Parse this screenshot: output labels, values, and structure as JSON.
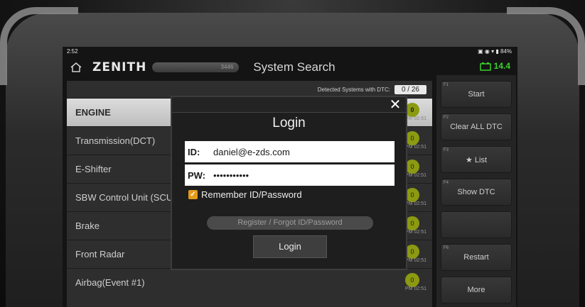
{
  "status_bar": {
    "time": "2:52",
    "battery": "84%"
  },
  "header": {
    "brand": "ZENITH",
    "vin_partial": "3446",
    "title": "System Search",
    "voltage": "14.4"
  },
  "list": {
    "detected_label": "Detected Systems with DTC:",
    "detected_value": "0 / 26",
    "rows": [
      {
        "name": "ENGINE",
        "count": "0",
        "time": "PM 02:51"
      },
      {
        "name": "Transmission(DCT)",
        "count": "0",
        "time": "PM 02:51"
      },
      {
        "name": "E-Shifter",
        "count": "0",
        "time": "PM 02:51"
      },
      {
        "name": "SBW Control Unit (SCU",
        "count": "0",
        "time": "PM 02:51"
      },
      {
        "name": "Brake",
        "count": "0",
        "time": "PM 02:51"
      },
      {
        "name": "Front Radar",
        "count": "0",
        "time": "PM 02:51"
      },
      {
        "name": "Airbag(Event #1)",
        "count": "0",
        "time": "PM 02:51"
      }
    ]
  },
  "side_buttons": [
    {
      "fkey": "F1",
      "label": "Start"
    },
    {
      "fkey": "F2",
      "label": "Clear ALL DTC"
    },
    {
      "fkey": "F3",
      "label": "★ List"
    },
    {
      "fkey": "F4",
      "label": "Show DTC"
    },
    {
      "fkey": "",
      "label": ""
    },
    {
      "fkey": "F6",
      "label": "Restart"
    },
    {
      "fkey": "",
      "label": "More"
    }
  ],
  "login": {
    "title": "Login",
    "close": "✕",
    "id_label": "ID:",
    "id_value": "daniel@e-zds.com",
    "pw_label": "PW:",
    "pw_value": "•••••••••••",
    "remember_label": "Remember ID/Password",
    "remember_checked": true,
    "register_label": "Register / Forgot ID/Password",
    "login_label": "Login"
  },
  "colors": {
    "accent_check": "#e59a1a",
    "battery_green": "#3ccf2c",
    "dtc_badge": "#8c9a12"
  }
}
